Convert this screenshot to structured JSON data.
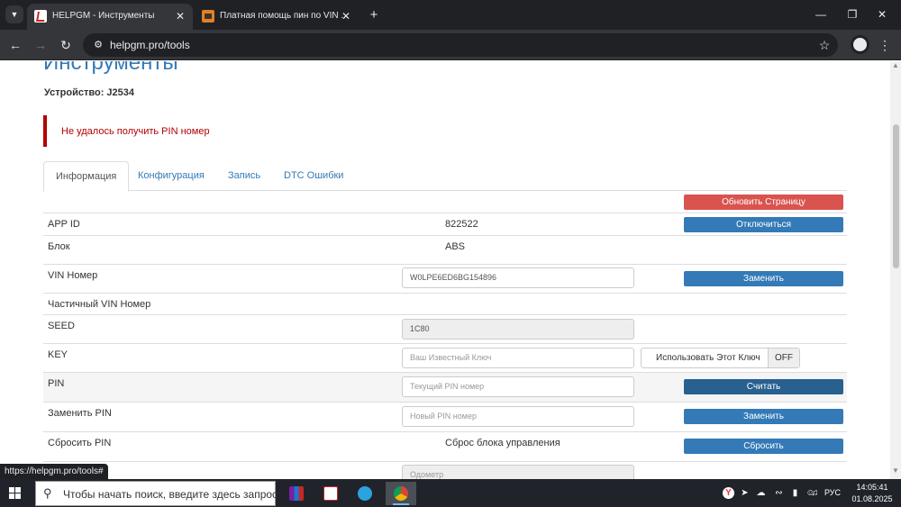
{
  "browser": {
    "tabs": [
      {
        "title": "HELPGM - Инструменты",
        "active": true
      },
      {
        "title": "Платная помощь пин по VIN ...",
        "active": false
      }
    ],
    "url": "helpgm.pro/tools",
    "status_url": "https://helpgm.pro/tools#"
  },
  "page": {
    "title": "Инструменты",
    "device_label": "Устройство: J2534",
    "alert": "Не удалось получить PIN номер",
    "tabs": [
      "Информация",
      "Конфигурация",
      "Запись",
      "DTC Ошибки"
    ],
    "refresh_button": "Обновить Страницу",
    "rows": {
      "app_id": {
        "label": "APP ID",
        "value": "822522",
        "button": "Отключиться"
      },
      "block": {
        "label": "Блок",
        "value": "ABS"
      },
      "vin": {
        "label": "VIN Номер",
        "value": "W0LPE6ED6BG154896",
        "button": "Заменить"
      },
      "partial_vin": {
        "label": "Частичный VIN Номер"
      },
      "seed": {
        "label": "SEED",
        "value": "1C80"
      },
      "key": {
        "label": "KEY",
        "placeholder": "Ваш Известный Ключ",
        "toggle_label": "Использовать Этот Ключ",
        "toggle_state": "OFF"
      },
      "pin": {
        "label": "PIN",
        "placeholder": "Текущий PIN номер",
        "button": "Считать"
      },
      "change_pin": {
        "label": "Заменить PIN",
        "placeholder": "Новый PIN номер",
        "button": "Заменить"
      },
      "reset_pin": {
        "label": "Сбросить PIN",
        "value": "Сброс блока управления",
        "button": "Сбросить"
      },
      "odometer": {
        "placeholder": "Одометр"
      }
    }
  },
  "taskbar": {
    "search_placeholder": "Чтобы начать поиск, введите здесь запрос",
    "language": "РУС",
    "time": "14:05:41",
    "date": "01.08.2025"
  },
  "colors": {
    "link": "#337ab7",
    "danger": "#d9534f",
    "alert_text": "#b30000",
    "primary_button": "#337ab7",
    "taskbar": "#20242a",
    "browser_dark": "#202124"
  }
}
